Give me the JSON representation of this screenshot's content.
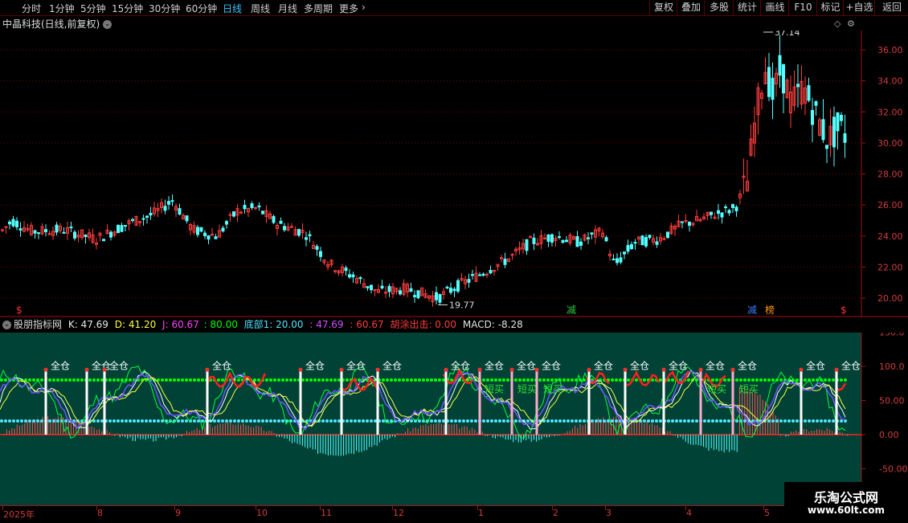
{
  "toolbar": {
    "periods": [
      "分时",
      "1分钟",
      "5分钟",
      "15分钟",
      "30分钟",
      "60分钟",
      "日线",
      "周线",
      "月线",
      "多周期",
      "更多"
    ],
    "active_period": "日线",
    "more_arrow": "›",
    "right_buttons": [
      "复权",
      "叠加",
      "多股",
      "统计",
      "画线",
      "F10",
      "标记",
      "+自选",
      "返回"
    ]
  },
  "chart": {
    "title": "中晶科技(日线,前复权)",
    "high_marker": "37.14",
    "low_marker": "19.77",
    "price_ticks": [
      "36.00",
      "34.00",
      "32.00",
      "30.00",
      "28.00",
      "26.00",
      "24.00",
      "22.00",
      "20.00"
    ],
    "badges": [
      {
        "text": "$",
        "color": "#ff3030"
      },
      {
        "text": "减",
        "color": "#2ecc40"
      },
      {
        "text": "减",
        "color": "#3a7cff"
      },
      {
        "text": "榜",
        "color": "#ff9900"
      },
      {
        "text": "$",
        "color": "#ff3030"
      }
    ]
  },
  "indicator": {
    "name": "股朋指标网",
    "K": "K: 47.69",
    "D": "D: 41.20",
    "J": "J: 60.67",
    "level80": ": 80.00",
    "bottom": "底部1: 20.00",
    "v47": ": 47.69",
    "v60": ": 60.67",
    "huitu": "胡涂出击: 0.00",
    "macd": "MACD: -8.28",
    "ticks": [
      "150.0",
      "100.0",
      "50.00",
      "0.00",
      "-50.00"
    ],
    "full_label": "全仓",
    "short_label": "短买"
  },
  "time_axis": [
    "2025年",
    "8",
    "9",
    "10",
    "11",
    "12",
    "1",
    "2",
    "3",
    "4",
    "5"
  ],
  "watermark": {
    "line1": "乐淘公式网",
    "line2": "www.60lt.com"
  },
  "colors": {
    "up": "#ff3c3c",
    "down": "#54ffff",
    "grid": "#7a0000",
    "ind_bg": "#004236",
    "green_line": "#00ff00",
    "cyan_line": "#4fe6ff"
  }
}
